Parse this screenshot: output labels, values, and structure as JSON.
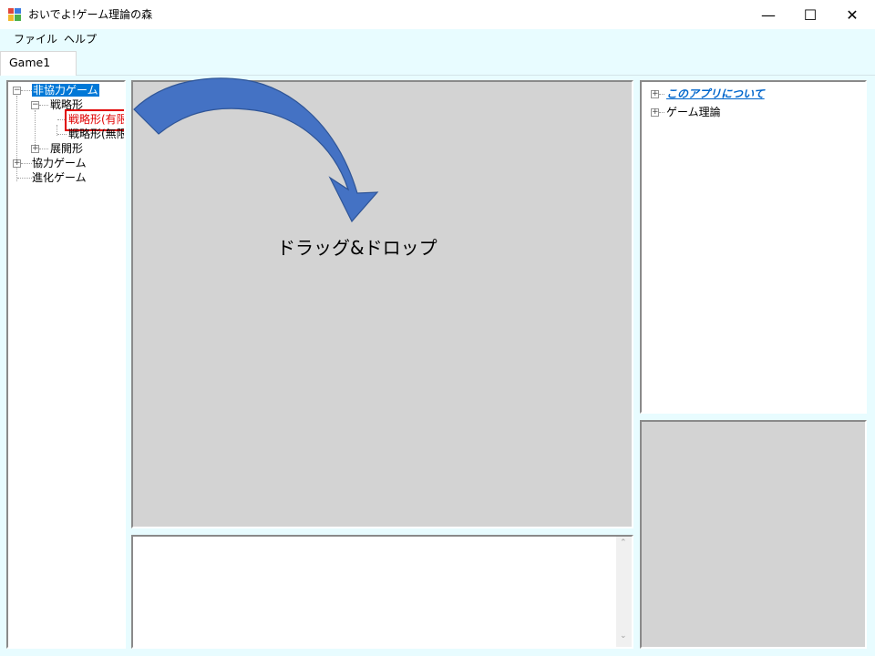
{
  "window": {
    "title": "おいでよ!ゲーム理論の森",
    "minimize_glyph": "—",
    "maximize_glyph": "☐",
    "close_glyph": "✕"
  },
  "menu": {
    "items": [
      "ファイル",
      "ヘルプ"
    ]
  },
  "tabs": [
    {
      "label": "Game1",
      "selected": true
    }
  ],
  "left_tree": {
    "nodes": [
      {
        "label": "非協力ゲーム",
        "level": 0,
        "expander": "−",
        "selected": true
      },
      {
        "label": "戦略形",
        "level": 1,
        "expander": "−"
      },
      {
        "label": "戦略形(有限",
        "level": 2,
        "highlighted": true
      },
      {
        "label": "戦略形(無限",
        "level": 2
      },
      {
        "label": "展開形",
        "level": 1,
        "expander": "+"
      },
      {
        "label": "協力ゲーム",
        "level": 0,
        "expander": "+"
      },
      {
        "label": "進化ゲーム",
        "level": 0
      }
    ]
  },
  "annotation": {
    "text": "ドラッグ&ドロップ",
    "arrow_color": "#4472c4"
  },
  "right_tree": {
    "nodes": [
      {
        "label": "このアプリについて",
        "expander": "+",
        "link": true
      },
      {
        "label": "ゲーム理論",
        "expander": "+"
      }
    ]
  },
  "log": {
    "scroll_up": "⌃",
    "scroll_down": "⌄"
  },
  "colors": {
    "client_bg": "#e8fcff",
    "panel_gray": "#d3d3d3",
    "selection": "#0078d7",
    "highlight_red": "#e00000",
    "link": "#0066cc"
  }
}
